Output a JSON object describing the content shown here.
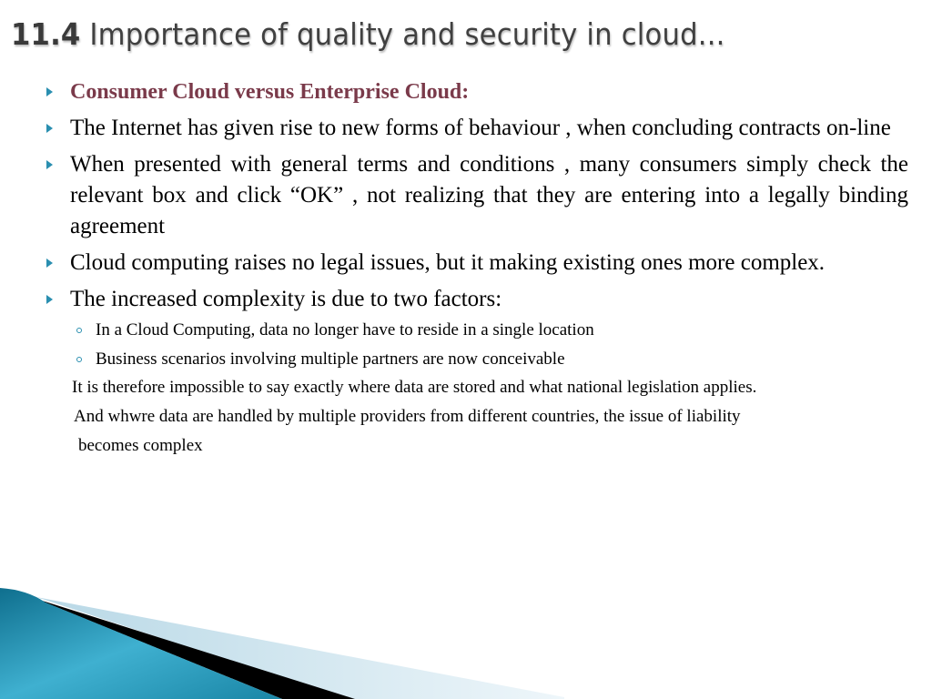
{
  "slide": {
    "title_number": "11.4",
    "title_text": "Importance of quality and security in cloud...",
    "bullets": [
      {
        "text": "Consumer Cloud versus Enterprise Cloud:"
      },
      {
        "text": "The Internet has given rise to new forms of behaviour , when concluding contracts on-line"
      },
      {
        "text": "When presented with general terms and conditions , many consumers simply check the relevant box and click “OK” , not realizing that they are entering into a legally binding agreement"
      },
      {
        "text": "Cloud computing raises no legal issues, but it making existing ones more complex."
      },
      {
        "text": "The increased complexity is due to two factors:"
      }
    ],
    "sub_bullets": [
      {
        "text": "In a Cloud Computing, data no longer have to reside in a single location"
      },
      {
        "text": "Business scenarios involving multiple partners are now conceivable"
      }
    ],
    "paragraphs": [
      {
        "text": "It is therefore impossible to say exactly where data are stored and what national legislation applies."
      },
      {
        "text": "And whwre data are handled by multiple providers from different countries, the issue of liability"
      },
      {
        "text": "becomes complex"
      }
    ],
    "icons": {
      "bullet": "triangle-bullet-icon",
      "sub_bullet": "circle-bullet-icon"
    },
    "colors": {
      "heading": "#7a3a4a",
      "bullet": "#2a8fb0",
      "title": "#404040",
      "decor_blue": "#1f87a8",
      "decor_light": "#d4e8f0"
    }
  }
}
